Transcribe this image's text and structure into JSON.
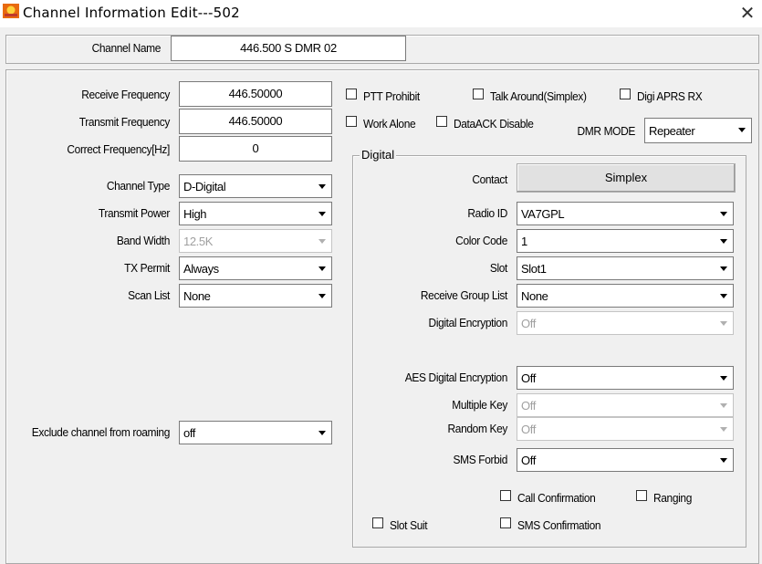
{
  "window": {
    "title": "Channel Information Edit---502",
    "close_glyph": "✕"
  },
  "channel_name": {
    "label": "Channel Name",
    "value": "446.500 S DMR 02"
  },
  "left": {
    "receive_frequency": {
      "label": "Receive Frequency",
      "value": "446.50000"
    },
    "transmit_frequency": {
      "label": "Transmit Frequency",
      "value": "446.50000"
    },
    "correct_frequency": {
      "label": "Correct Frequency[Hz]",
      "value": "0"
    },
    "channel_type": {
      "label": "Channel Type",
      "value": "D-Digital"
    },
    "transmit_power": {
      "label": "Transmit Power",
      "value": "High"
    },
    "band_width": {
      "label": "Band Width",
      "value": "12.5K"
    },
    "tx_permit": {
      "label": "TX Permit",
      "value": "Always"
    },
    "scan_list": {
      "label": "Scan List",
      "value": "None"
    },
    "exclude_roaming": {
      "label": "Exclude channel from roaming",
      "value": "off"
    }
  },
  "checks": {
    "ptt_prohibit": "PTT Prohibit",
    "talk_around": "Talk Around(Simplex)",
    "digi_aprs_rx": "Digi APRS RX",
    "work_alone": "Work Alone",
    "dataack_disable": "DataACK Disable"
  },
  "dmr_mode": {
    "label": "DMR MODE",
    "value": "Repeater"
  },
  "digital": {
    "legend": "Digital",
    "contact": {
      "label": "Contact",
      "value": "Simplex"
    },
    "radio_id": {
      "label": "Radio ID",
      "value": "VA7GPL"
    },
    "color_code": {
      "label": "Color Code",
      "value": "1"
    },
    "slot": {
      "label": "Slot",
      "value": "Slot1"
    },
    "receive_group_list": {
      "label": "Receive Group List",
      "value": "None"
    },
    "digital_encryption": {
      "label": "Digital Encryption",
      "value": "Off"
    },
    "aes_digital_encryption": {
      "label": "AES Digital Encryption",
      "value": "Off"
    },
    "multiple_key": {
      "label": "Multiple Key",
      "value": "Off"
    },
    "random_key": {
      "label": "Random Key",
      "value": "Off"
    },
    "sms_forbid": {
      "label": "SMS Forbid",
      "value": "Off"
    },
    "call_confirmation": "Call Confirmation",
    "ranging": "Ranging",
    "slot_suit": "Slot Suit",
    "sms_confirmation": "SMS Confirmation"
  },
  "colors": {
    "window_bg": "#f0f0f0",
    "titlebar_bg": "#ffffff",
    "border": "#7a7a7a"
  }
}
